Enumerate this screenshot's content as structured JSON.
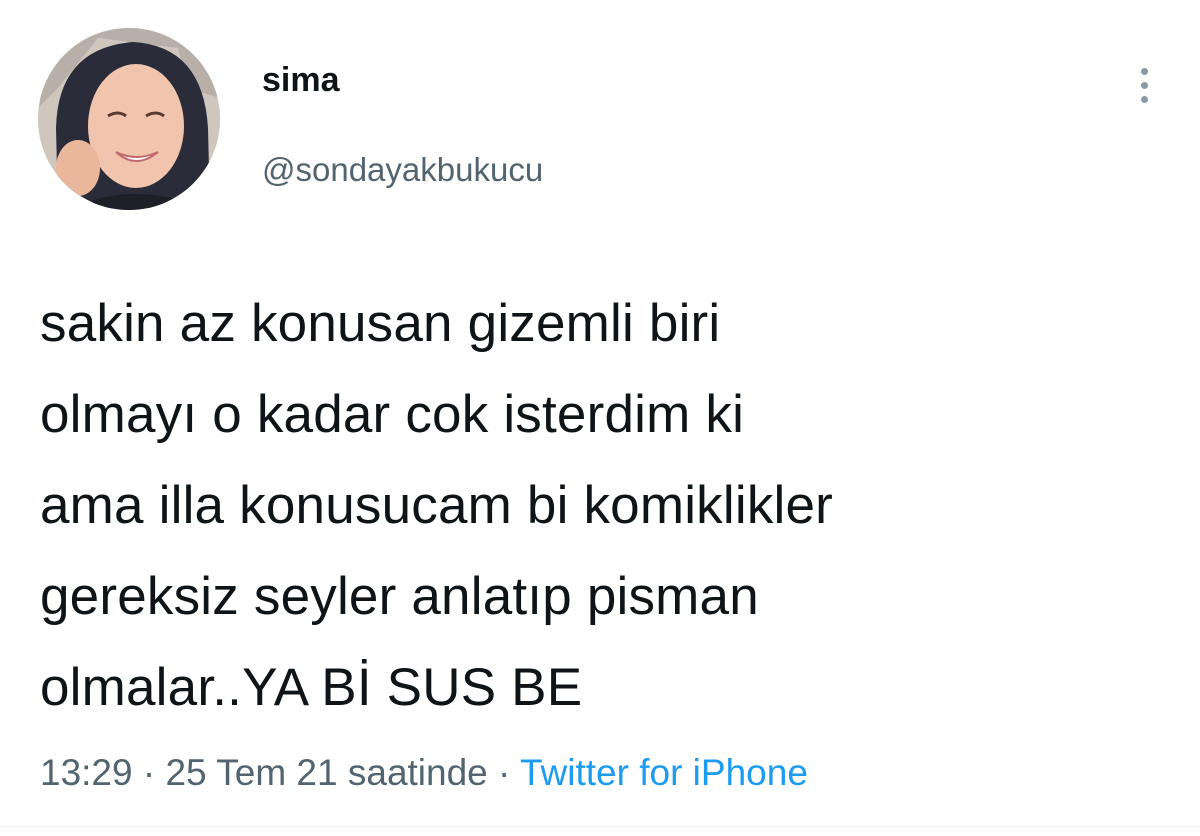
{
  "author": {
    "display_name": "sima",
    "handle": "@sondayakbukucu",
    "avatar_icon": "profile-photo"
  },
  "more_icon": "more-vertical-icon",
  "tweet": {
    "lines": [
      "sakin az konusan gizemli biri",
      "olmayı o kadar cok isterdim ki",
      "ama illa konusucam bi komiklikler",
      "gereksiz seyler anlatıp pisman",
      "olmalar..YA Bİ SUS BE"
    ]
  },
  "meta": {
    "time": "13:29",
    "separator": " · ",
    "date": "25 Tem 21 saatinde",
    "source": "Twitter for iPhone"
  },
  "colors": {
    "text": "#0f1419",
    "secondary": "#536471",
    "link": "#1d9bf0"
  }
}
